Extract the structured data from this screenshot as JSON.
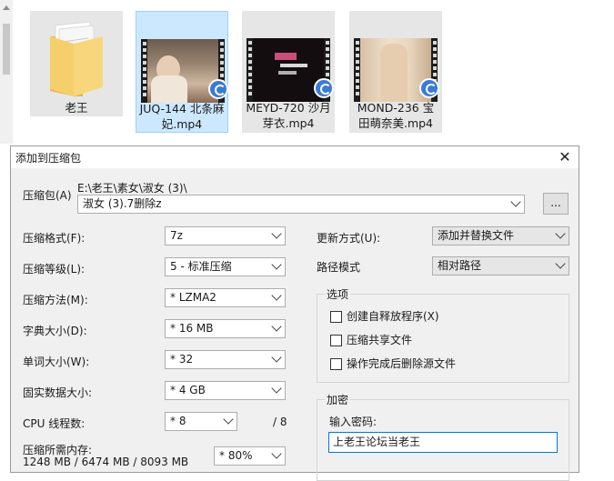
{
  "explorer": {
    "tiles": [
      {
        "label": "老王",
        "kind": "folder-icon"
      },
      {
        "label_line1": "JUQ-144 北条麻",
        "label_line2": "妃.mp4",
        "selected": true
      },
      {
        "label_line1": "MEYD-720 沙月",
        "label_line2": "芽衣.mp4"
      },
      {
        "label_line1": "MOND-236 宝",
        "label_line2": "田萌奈美.mp4"
      }
    ]
  },
  "dialog": {
    "title": "添加到压缩包",
    "close_glyph": "✕",
    "archive_label": "压缩包(A)",
    "archive_path": "E:\\老王\\素女\\淑女 (3)\\",
    "archive_name": "淑女 (3).7删除z",
    "browse_label": "...",
    "format_label": "压缩格式(F):",
    "format_value": "7z",
    "level_label": "压缩等级(L):",
    "level_value": "5 - 标准压缩",
    "method_label": "压缩方法(M):",
    "method_value": "* LZMA2",
    "dict_label": "字典大小(D):",
    "dict_value": "* 16 MB",
    "word_label": "单词大小(W):",
    "word_value": "* 32",
    "solid_label": "固实数据大小:",
    "solid_value": "* 4 GB",
    "cpu_label": "CPU 线程数:",
    "cpu_value": "* 8",
    "cpu_total": "/ 8",
    "mem_label": "压缩所需内存:",
    "mem_value": "1248 MB / 6474 MB / 8093 MB",
    "mem_percent": "* 80%",
    "update_label": "更新方式(U):",
    "update_value": "添加并替换文件",
    "path_label": "路径模式",
    "path_value": "相对路径",
    "options_caption": "选项",
    "opt_sfx": "创建自释放程序(X)",
    "opt_shared": "压缩共享文件",
    "opt_delete": "操作完成后删除源文件",
    "encrypt_caption": "加密",
    "password_label": "输入密码:",
    "password_value": "上老王论坛当老王"
  }
}
